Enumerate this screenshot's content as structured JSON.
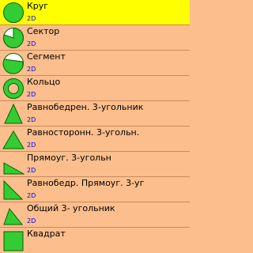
{
  "colors": {
    "row_bg": "#fbbe8c",
    "selected_bg": "#ffff00",
    "shape_fill": "#33cc33",
    "shape_stroke": "#006600",
    "tag_color": "#0000ff"
  },
  "items": [
    {
      "label": "Круг",
      "tag": "2D",
      "icon": "circle-icon",
      "selected": true
    },
    {
      "label": "Сектор",
      "tag": "2D",
      "icon": "sector-icon"
    },
    {
      "label": "Сегмент",
      "tag": "2D",
      "icon": "segment-icon"
    },
    {
      "label": "Кольцо",
      "tag": "2D",
      "icon": "ring-icon"
    },
    {
      "label": "Равнобедрен. 3-угольник",
      "tag": "2D",
      "icon": "isosceles-triangle-icon"
    },
    {
      "label": "Равносторонн. 3-угольн.",
      "tag": "2D",
      "icon": "equilateral-triangle-icon"
    },
    {
      "label": "Прямоуг. 3-угольн",
      "tag": "2D",
      "icon": "right-triangle-icon"
    },
    {
      "label": "Равнобедр. Прямоуг. 3-уг",
      "tag": "2D",
      "icon": "isosceles-right-triangle-icon"
    },
    {
      "label": "Общий 3- угольник",
      "tag": "2D",
      "icon": "general-triangle-icon"
    },
    {
      "label": "Квадрат",
      "tag": "",
      "icon": "square-icon"
    }
  ]
}
